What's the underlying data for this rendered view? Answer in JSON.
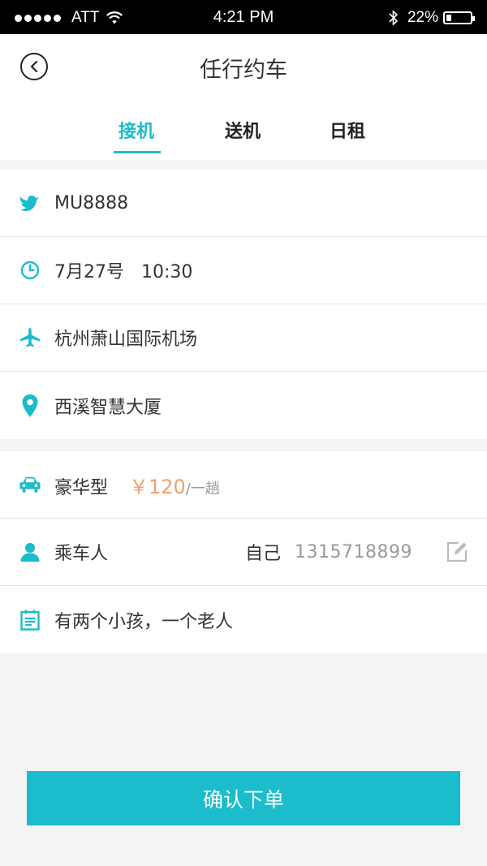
{
  "status_bar": {
    "carrier": "ATT",
    "time": "4:21 PM",
    "battery_percent": "22%",
    "battery_level": 0.22
  },
  "header": {
    "title": "任行约车",
    "tabs": [
      {
        "label": "接机",
        "active": true
      },
      {
        "label": "送机",
        "active": false
      },
      {
        "label": "日租",
        "active": false
      }
    ]
  },
  "trip": {
    "flight_number": "MU8888",
    "date": "7月27号",
    "time": "10:30",
    "airport": "杭州萧山国际机场",
    "destination": "西溪智慧大厦"
  },
  "order": {
    "car_type": "豪华型",
    "price": "￥120",
    "price_unit": "/一趟",
    "passenger_label": "乘车人",
    "passenger_name": "自己",
    "passenger_phone": "1315718899",
    "remark": "有两个小孩，一个老人"
  },
  "actions": {
    "confirm_label": "确认下单"
  },
  "colors": {
    "accent": "#1bbccb",
    "price": "#f0a06a"
  }
}
